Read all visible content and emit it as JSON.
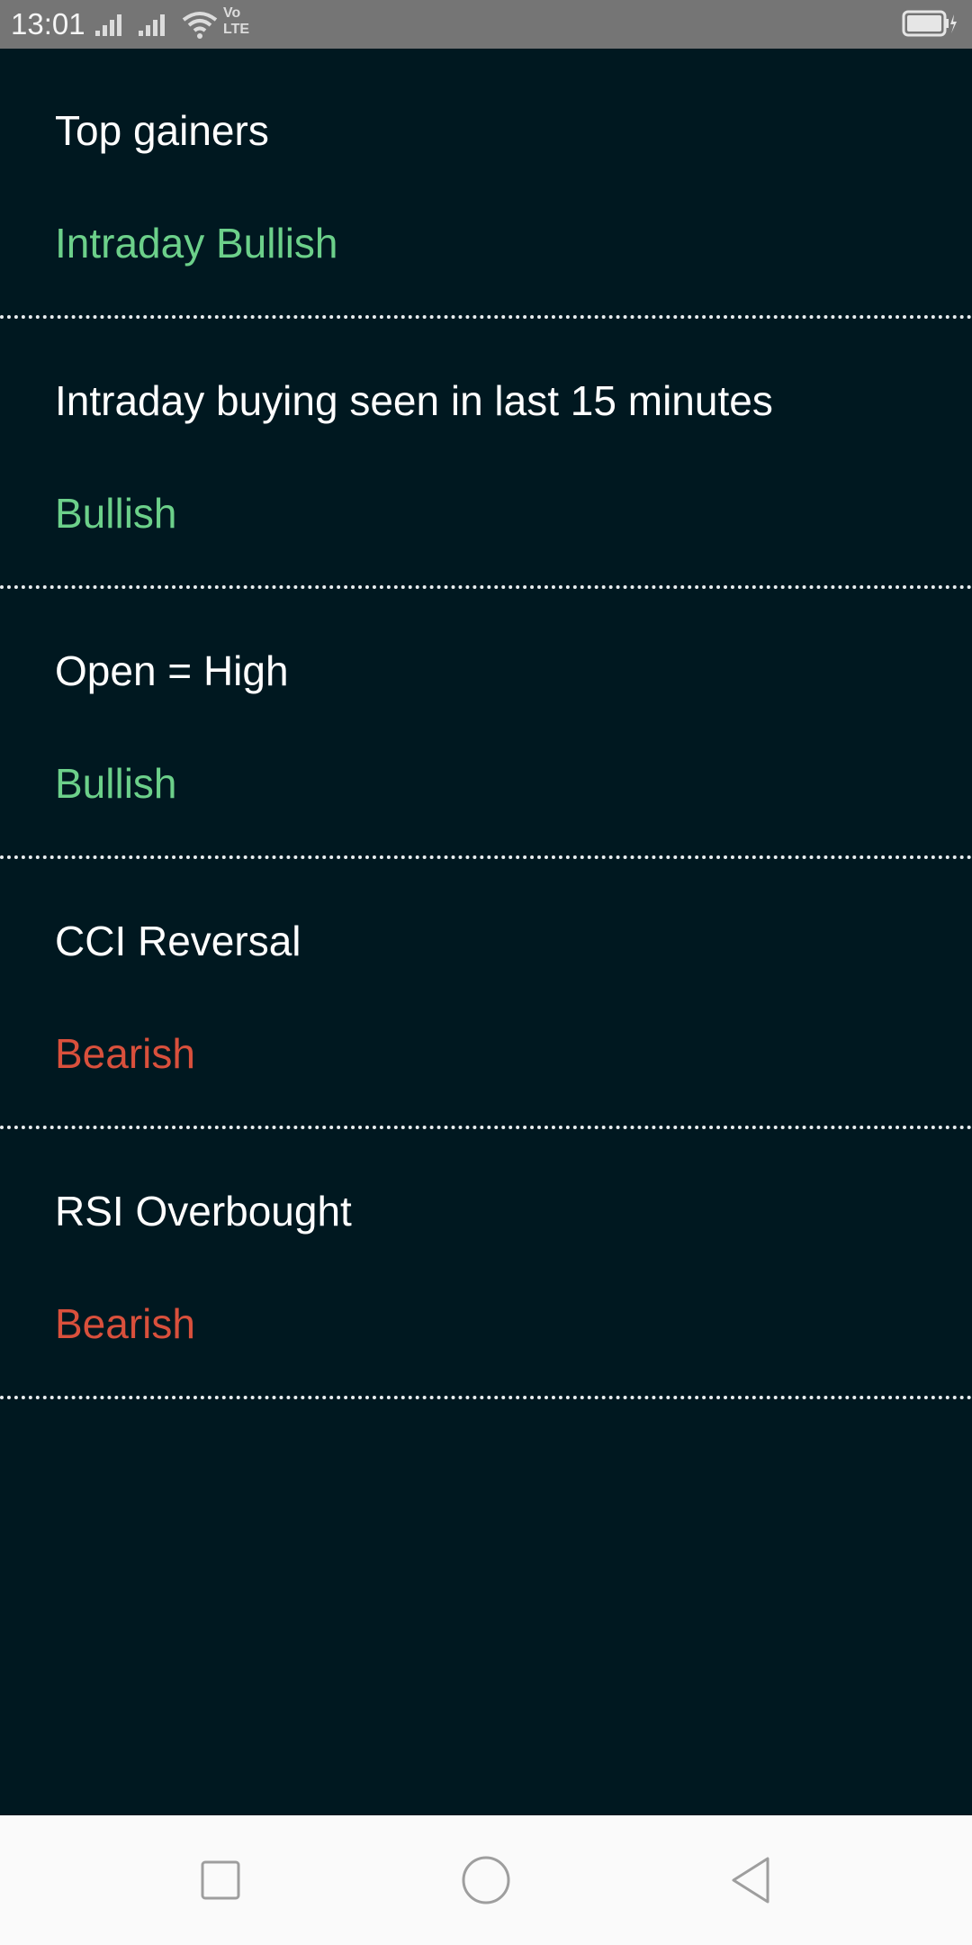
{
  "status_bar": {
    "time": "13:01",
    "icons": [
      "signal-icon",
      "signal-icon",
      "wifi-icon",
      "volte-icon",
      "battery-icon"
    ],
    "volte_top": "Vo",
    "volte_bottom": "LTE"
  },
  "signals": [
    {
      "title": "Top gainers",
      "signal": "Intraday Bullish",
      "sentiment": "bullish"
    },
    {
      "title": "Intraday buying seen in last 15 minutes",
      "signal": "Bullish",
      "sentiment": "bullish"
    },
    {
      "title": "Open = High",
      "signal": "Bullish",
      "sentiment": "bullish"
    },
    {
      "title": "CCI Reversal",
      "signal": "Bearish",
      "sentiment": "bearish"
    },
    {
      "title": "RSI Overbought",
      "signal": "Bearish",
      "sentiment": "bearish"
    }
  ],
  "colors": {
    "background": "#001820",
    "bullish": "#6cd08a",
    "bearish": "#d9503c",
    "divider": "#e8eef0"
  },
  "nav_bar": {
    "buttons": [
      "recents-icon",
      "home-icon",
      "back-icon"
    ]
  }
}
